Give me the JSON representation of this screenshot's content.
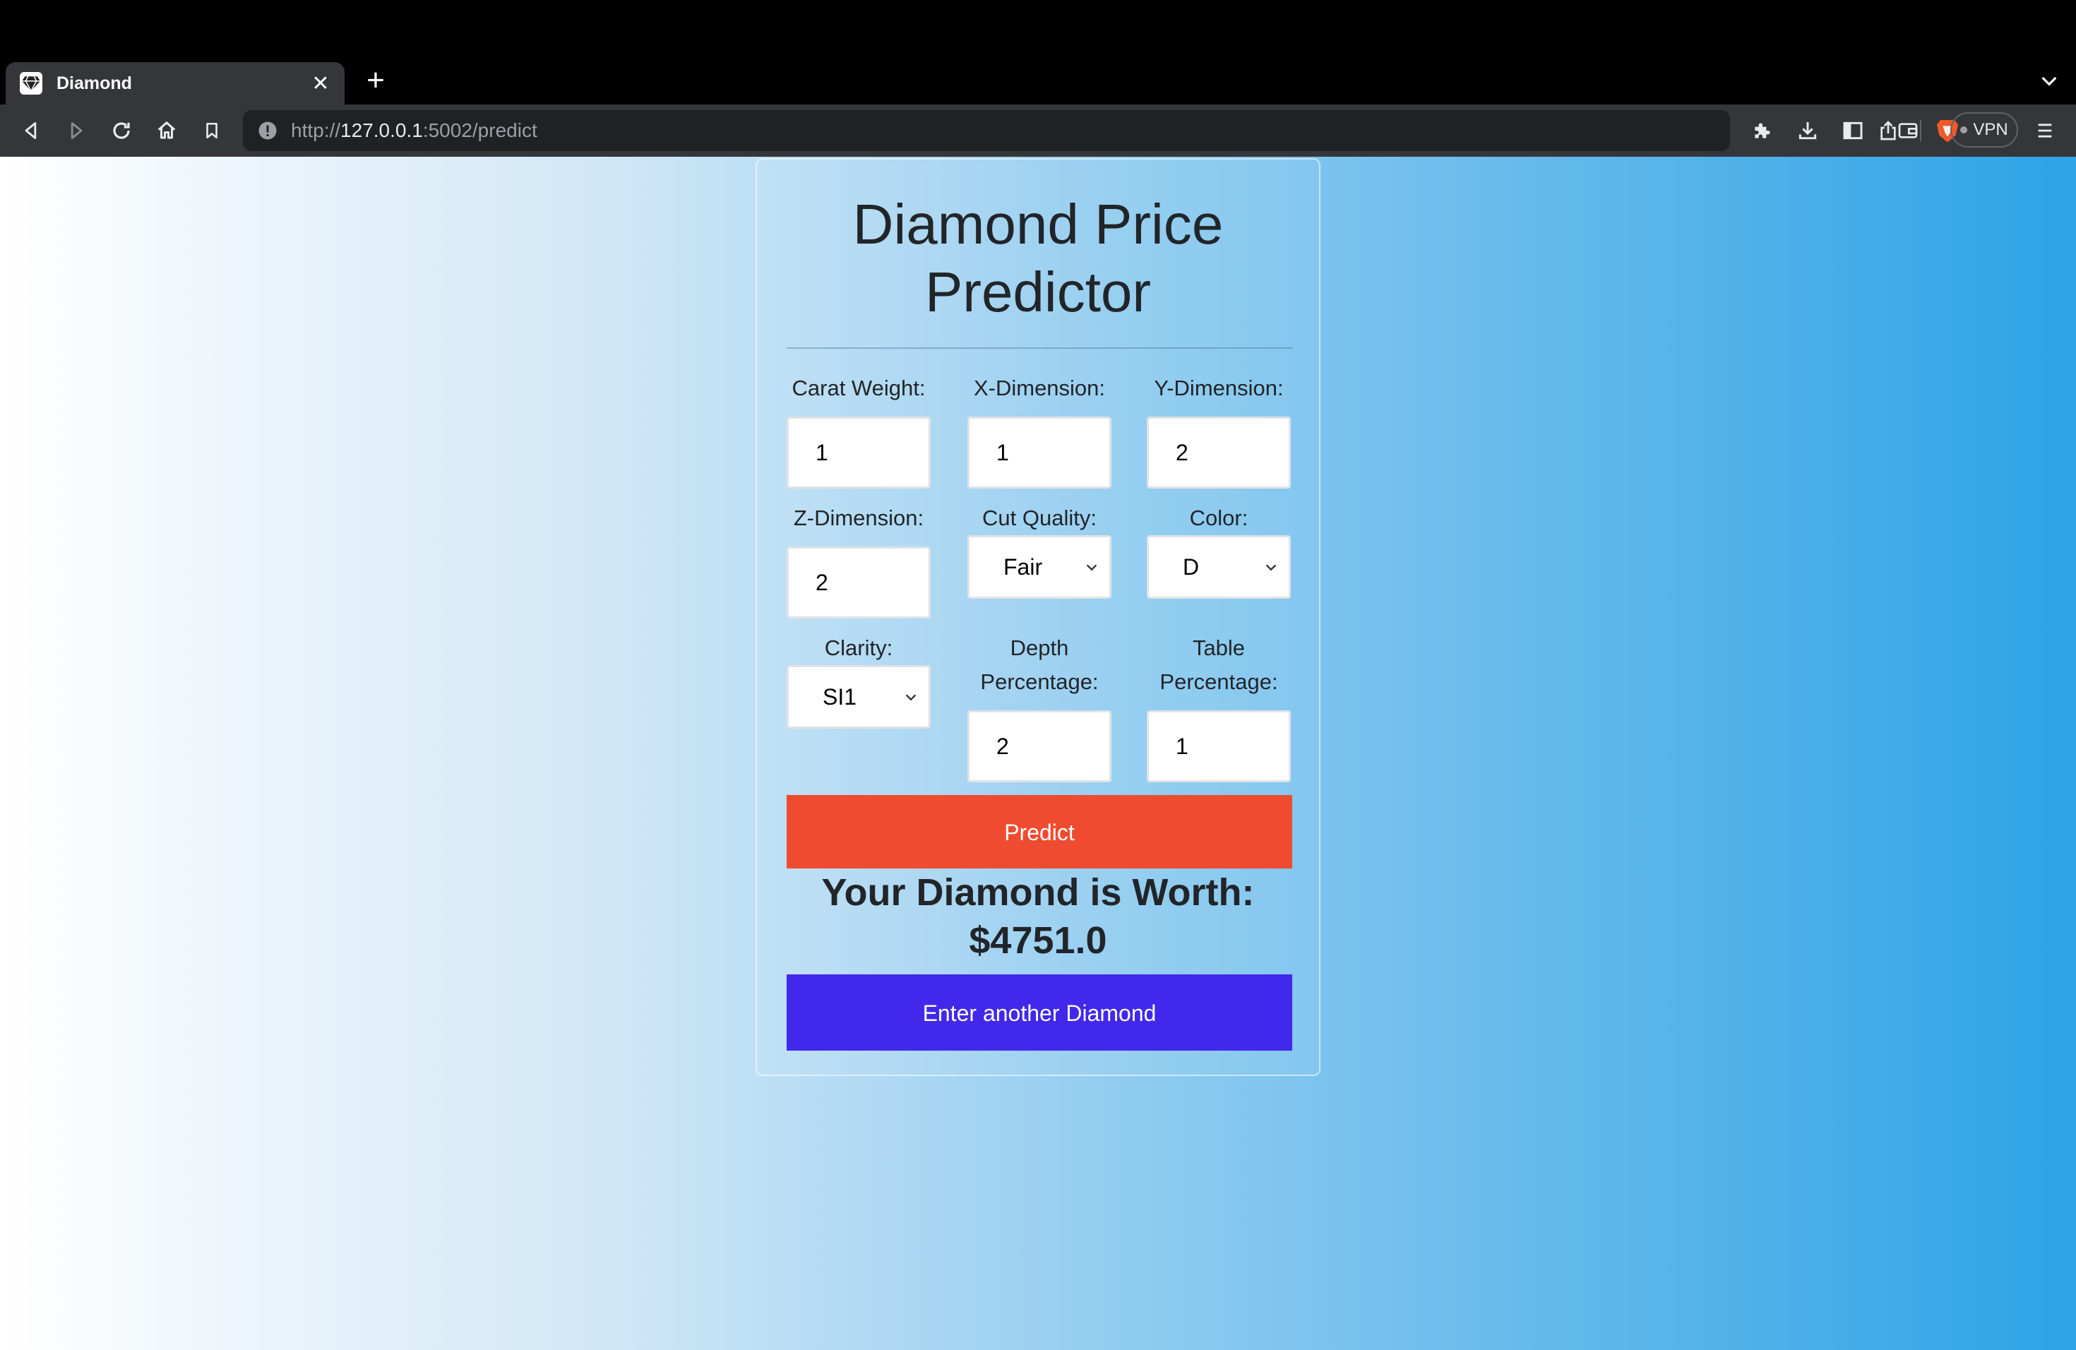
{
  "browser": {
    "tab_title": "Diamond",
    "url_prefix": "http://",
    "url_host": "127.0.0.1",
    "url_rest": ":5002/predict",
    "vpn_label": "VPN"
  },
  "page": {
    "title_line1": "Diamond Price",
    "title_line2": "Predictor",
    "fields": {
      "carat": {
        "label": "Carat Weight:",
        "value": "1"
      },
      "x": {
        "label": "X-Dimension:",
        "value": "1"
      },
      "y": {
        "label": "Y-Dimension:",
        "value": "2"
      },
      "z": {
        "label": "Z-Dimension:",
        "value": "2"
      },
      "cut": {
        "label": "Cut Quality:",
        "value": "Fair"
      },
      "color": {
        "label": "Color:",
        "value": "D"
      },
      "clarity": {
        "label": "Clarity:",
        "value": "SI1"
      },
      "depth": {
        "label_line1": "Depth",
        "label_line2": "Percentage:",
        "value": "2"
      },
      "table": {
        "label_line1": "Table",
        "label_line2": "Percentage:",
        "value": "1"
      }
    },
    "predict_button": "Predict",
    "result_line1": "Your Diamond is Worth:",
    "result_line2": "$4751.0",
    "another_button": "Enter another Diamond"
  },
  "colors": {
    "predict": "#ef4b30",
    "another": "#4228ea",
    "gradient_end": "#2da4e6"
  }
}
